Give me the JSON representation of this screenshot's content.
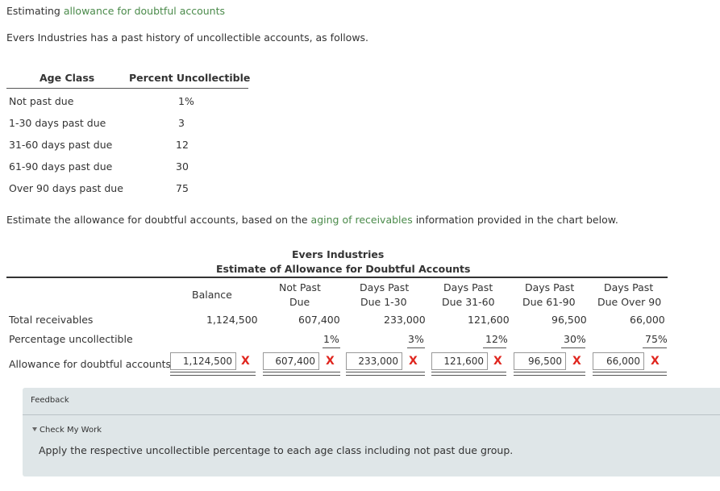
{
  "header": {
    "prefix": "Estimating ",
    "link": "allowance for doubtful accounts"
  },
  "intro": "Evers Industries has a past history of uncollectible accounts, as follows.",
  "age_table": {
    "col_age": "Age Class",
    "col_pct": "Percent Uncollectible",
    "rows": [
      {
        "label": "Not past due",
        "pct": "1%"
      },
      {
        "label": "1-30 days past due",
        "pct": "3"
      },
      {
        "label": "31-60 days past due",
        "pct": "12"
      },
      {
        "label": "61-90 days past due",
        "pct": "30"
      },
      {
        "label": "Over 90 days past due",
        "pct": "75"
      }
    ]
  },
  "instruction": {
    "before": "Estimate the allowance for doubtful accounts, based on the ",
    "link": "aging of receivables",
    "after": " information provided in the chart below."
  },
  "estimate": {
    "company": "Evers Industries",
    "title": "Estimate of Allowance for Doubtful Accounts",
    "columns": [
      {
        "l1": "Balance",
        "l2": ""
      },
      {
        "l1": "Not Past",
        "l2": "Due"
      },
      {
        "l1": "Days Past",
        "l2": "Due 1-30"
      },
      {
        "l1": "Days Past",
        "l2": "Due 31-60"
      },
      {
        "l1": "Days Past",
        "l2": "Due 61-90"
      },
      {
        "l1": "Days Past",
        "l2": "Due Over 90"
      }
    ],
    "row_receivables": {
      "label": "Total receivables",
      "values": [
        "1,124,500",
        "607,400",
        "233,000",
        "121,600",
        "96,500",
        "66,000"
      ]
    },
    "row_percentage": {
      "label": "Percentage uncollectible",
      "values": [
        "1%",
        "3%",
        "12%",
        "30%",
        "75%"
      ]
    },
    "row_allowance": {
      "label": "Allowance for doubtful accounts",
      "answers": [
        "1,124,500",
        "607,400",
        "233,000",
        "121,600",
        "96,500",
        "66,000"
      ],
      "mark": "X"
    }
  },
  "feedback": {
    "label": "Feedback",
    "check_label": "Check My Work",
    "text": "Apply the respective uncollectible percentage to each age class including not past due group."
  },
  "colors": {
    "link": "#4a8a4a",
    "error": "#e0261f",
    "panel": "#dfe6e8"
  }
}
